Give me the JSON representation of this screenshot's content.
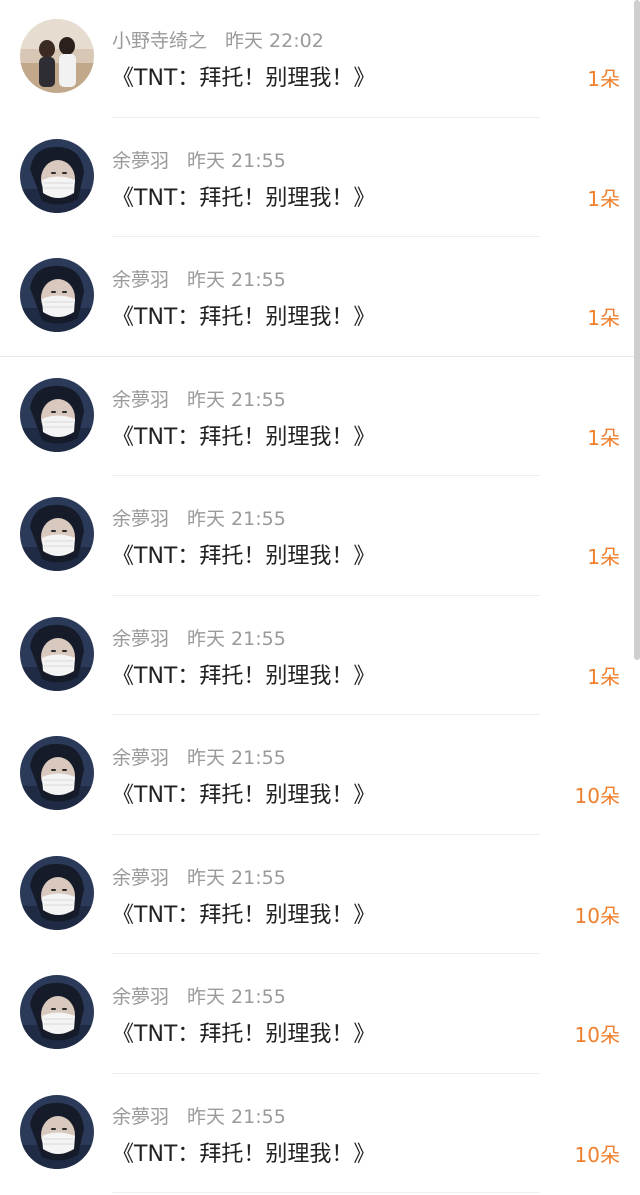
{
  "rows": [
    {
      "name": "小野寺绮之",
      "time": "昨天 22:02",
      "gift": "《TNT：拜托！别理我！》",
      "count": "1朵",
      "avatar": "couple-photo-avatar"
    },
    {
      "name": "余夢羽",
      "time": "昨天 21:55",
      "gift": "《TNT：拜托！别理我！》",
      "count": "1朵",
      "avatar": "masked-selfie-avatar"
    },
    {
      "name": "余夢羽",
      "time": "昨天 21:55",
      "gift": "《TNT：拜托！别理我！》",
      "count": "1朵",
      "avatar": "masked-selfie-avatar"
    },
    {
      "name": "余夢羽",
      "time": "昨天 21:55",
      "gift": "《TNT：拜托！别理我！》",
      "count": "1朵",
      "avatar": "masked-selfie-avatar"
    },
    {
      "name": "余夢羽",
      "time": "昨天 21:55",
      "gift": "《TNT：拜托！别理我！》",
      "count": "1朵",
      "avatar": "masked-selfie-avatar"
    },
    {
      "name": "余夢羽",
      "time": "昨天 21:55",
      "gift": "《TNT：拜托！别理我！》",
      "count": "1朵",
      "avatar": "masked-selfie-avatar"
    },
    {
      "name": "余夢羽",
      "time": "昨天 21:55",
      "gift": "《TNT：拜托！别理我！》",
      "count": "10朵",
      "avatar": "masked-selfie-avatar"
    },
    {
      "name": "余夢羽",
      "time": "昨天 21:55",
      "gift": "《TNT：拜托！别理我！》",
      "count": "10朵",
      "avatar": "masked-selfie-avatar"
    },
    {
      "name": "余夢羽",
      "time": "昨天 21:55",
      "gift": "《TNT：拜托！别理我！》",
      "count": "10朵",
      "avatar": "masked-selfie-avatar"
    },
    {
      "name": "余夢羽",
      "time": "昨天 21:55",
      "gift": "《TNT：拜托！别理我！》",
      "count": "10朵",
      "avatar": "masked-selfie-avatar"
    }
  ],
  "colors": {
    "background": "#ffffff",
    "meta_text": "#9a9a9a",
    "gift_text": "#222222",
    "count_text": "#ef7f2c",
    "divider": "#eeeeee"
  }
}
